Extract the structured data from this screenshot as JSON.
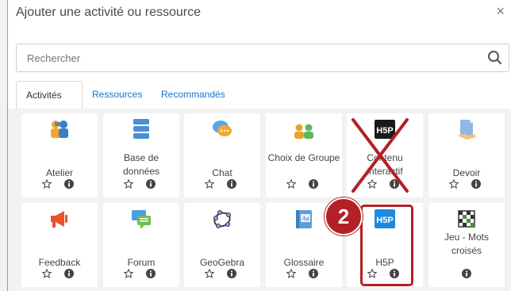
{
  "dialog": {
    "title": "Ajouter une activité ou ressource",
    "close": "×"
  },
  "search": {
    "placeholder": "Rechercher"
  },
  "tabs": [
    {
      "label": "Activités",
      "active": true
    },
    {
      "label": "Ressources",
      "active": false
    },
    {
      "label": "Recommandés",
      "active": false
    }
  ],
  "modules": [
    {
      "label": "Atelier",
      "icon": "workshop-icon"
    },
    {
      "label": "Base de données",
      "icon": "database-icon"
    },
    {
      "label": "Chat",
      "icon": "chat-icon"
    },
    {
      "label": "Choix de Groupe",
      "icon": "group-choice-icon"
    },
    {
      "label": "Contenu interactif",
      "icon": "h5p-dark-icon"
    },
    {
      "label": "Devoir",
      "icon": "assignment-icon"
    },
    {
      "label": "Feedback",
      "icon": "megaphone-icon"
    },
    {
      "label": "Forum",
      "icon": "forum-icon"
    },
    {
      "label": "GeoGebra",
      "icon": "geogebra-icon"
    },
    {
      "label": "Glossaire",
      "icon": "glossary-icon"
    },
    {
      "label": "H5P",
      "icon": "h5p-blue-icon"
    },
    {
      "label": "Jeu - Mots croisés",
      "icon": "crossword-icon"
    }
  ],
  "annotation": {
    "step_number": "2",
    "accent_color": "#b32025"
  }
}
